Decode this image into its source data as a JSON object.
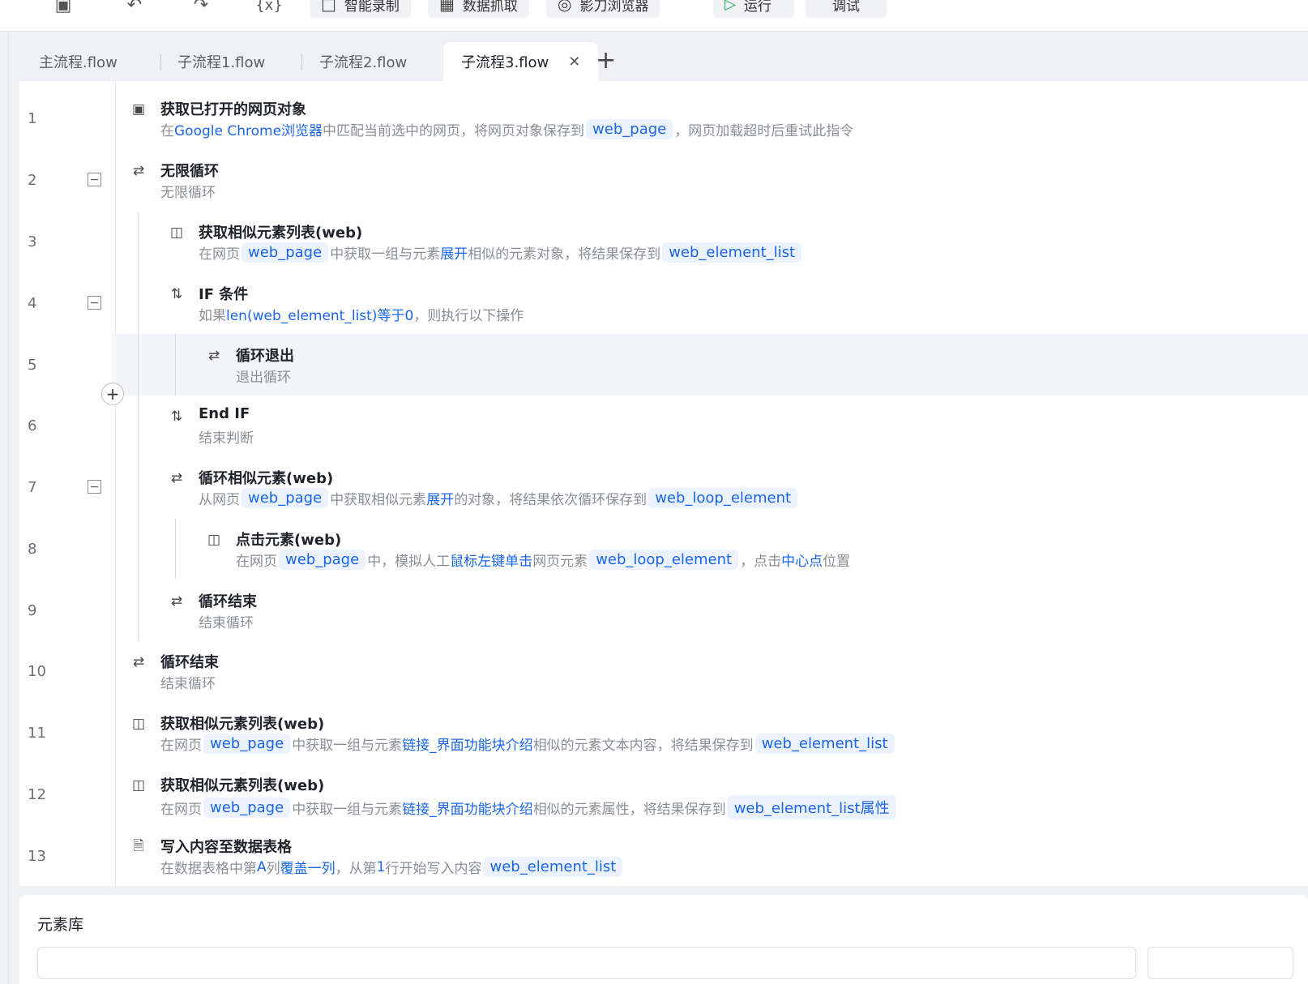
{
  "toolbar": {
    "icons": [
      "save-icon",
      "undo-icon",
      "redo-icon",
      "variable-icon"
    ],
    "buttons": [
      {
        "icon": "video-icon",
        "label": "智能录制"
      },
      {
        "icon": "table-icon",
        "label": "数据抓取"
      },
      {
        "icon": "browser-icon",
        "label": "影刀浏览器"
      },
      {
        "icon": "play-icon",
        "label": "运行"
      },
      {
        "icon": "",
        "label": "调试"
      }
    ]
  },
  "tabs": [
    {
      "label": "主流程.flow",
      "active": false
    },
    {
      "label": "子流程1.flow",
      "active": false
    },
    {
      "label": "子流程2.flow",
      "active": false
    },
    {
      "label": "子流程3.flow",
      "active": true
    }
  ],
  "steps": [
    {
      "num": "1",
      "title": "获取已打开的网页对象",
      "desc": [
        {
          "t": "在"
        },
        {
          "t": "Google Chrome浏览器",
          "b": 1
        },
        {
          "t": "中匹配当前选中的网页，将网页对象保存到"
        },
        {
          "t": "web_page",
          "v": 1
        },
        {
          "t": "，网页加载超时后重试此指令"
        }
      ]
    },
    {
      "num": "2",
      "title": "无限循环",
      "desc": [
        {
          "t": "无限循环"
        }
      ]
    },
    {
      "num": "3",
      "title": "获取相似元素列表(web)",
      "desc": [
        {
          "t": "在网页"
        },
        {
          "t": "web_page",
          "v": 1
        },
        {
          "t": "中获取一组与元素"
        },
        {
          "t": "展开",
          "b": 1
        },
        {
          "t": "相似的元素对象，将结果保存到"
        },
        {
          "t": "web_element_list",
          "v": 1
        }
      ]
    },
    {
      "num": "4",
      "title": "IF 条件",
      "desc": [
        {
          "t": "如果"
        },
        {
          "t": "len(web_element_list)等于0",
          "b": 1
        },
        {
          "t": "，则执行以下操作"
        }
      ]
    },
    {
      "num": "5",
      "title": "循环退出",
      "desc": [
        {
          "t": "退出循环"
        }
      ]
    },
    {
      "num": "6",
      "title": "End IF",
      "desc": [
        {
          "t": "结束判断"
        }
      ]
    },
    {
      "num": "7",
      "title": "循环相似元素(web)",
      "desc": [
        {
          "t": "从网页"
        },
        {
          "t": "web_page",
          "v": 1
        },
        {
          "t": "中获取相似元素"
        },
        {
          "t": "展开",
          "b": 1
        },
        {
          "t": "的对象，将结果依次循环保存到"
        },
        {
          "t": "web_loop_element",
          "v": 1
        }
      ]
    },
    {
      "num": "8",
      "title": "点击元素(web)",
      "desc": [
        {
          "t": "在网页"
        },
        {
          "t": "web_page",
          "v": 1
        },
        {
          "t": "中，模拟人工"
        },
        {
          "t": "鼠标左键单击",
          "b": 1
        },
        {
          "t": "网页元素"
        },
        {
          "t": "web_loop_element",
          "v": 1
        },
        {
          "t": "，点击"
        },
        {
          "t": "中心点",
          "b": 1
        },
        {
          "t": "位置"
        }
      ]
    },
    {
      "num": "9",
      "title": "循环结束",
      "desc": [
        {
          "t": "结束循环"
        }
      ]
    },
    {
      "num": "10",
      "title": "循环结束",
      "desc": [
        {
          "t": "结束循环"
        }
      ]
    },
    {
      "num": "11",
      "title": "获取相似元素列表(web)",
      "desc": [
        {
          "t": "在网页"
        },
        {
          "t": "web_page",
          "v": 1
        },
        {
          "t": "中获取一组与元素"
        },
        {
          "t": "链接_界面功能块介绍",
          "b": 1
        },
        {
          "t": "相似的元素文本内容，将结果保存到"
        },
        {
          "t": "web_element_list",
          "v": 1
        }
      ]
    },
    {
      "num": "12",
      "title": "获取相似元素列表(web)",
      "desc": [
        {
          "t": "在网页"
        },
        {
          "t": "web_page",
          "v": 1
        },
        {
          "t": "中获取一组与元素"
        },
        {
          "t": "链接_界面功能块介绍",
          "b": 1
        },
        {
          "t": "相似的元素属性，将结果保存到"
        },
        {
          "t": "web_element_list属性",
          "v": 1
        }
      ]
    },
    {
      "num": "13",
      "title": "写入内容至数据表格",
      "desc": [
        {
          "t": "在数据表格中第"
        },
        {
          "t": "A",
          "b": 1
        },
        {
          "t": "列"
        },
        {
          "t": "覆盖一列",
          "b": 1
        },
        {
          "t": "，从第"
        },
        {
          "t": "1",
          "b": 1
        },
        {
          "t": "行开始写入内容"
        },
        {
          "t": "web_element_list",
          "v": 1
        }
      ]
    }
  ],
  "library": {
    "title": "元素库"
  }
}
